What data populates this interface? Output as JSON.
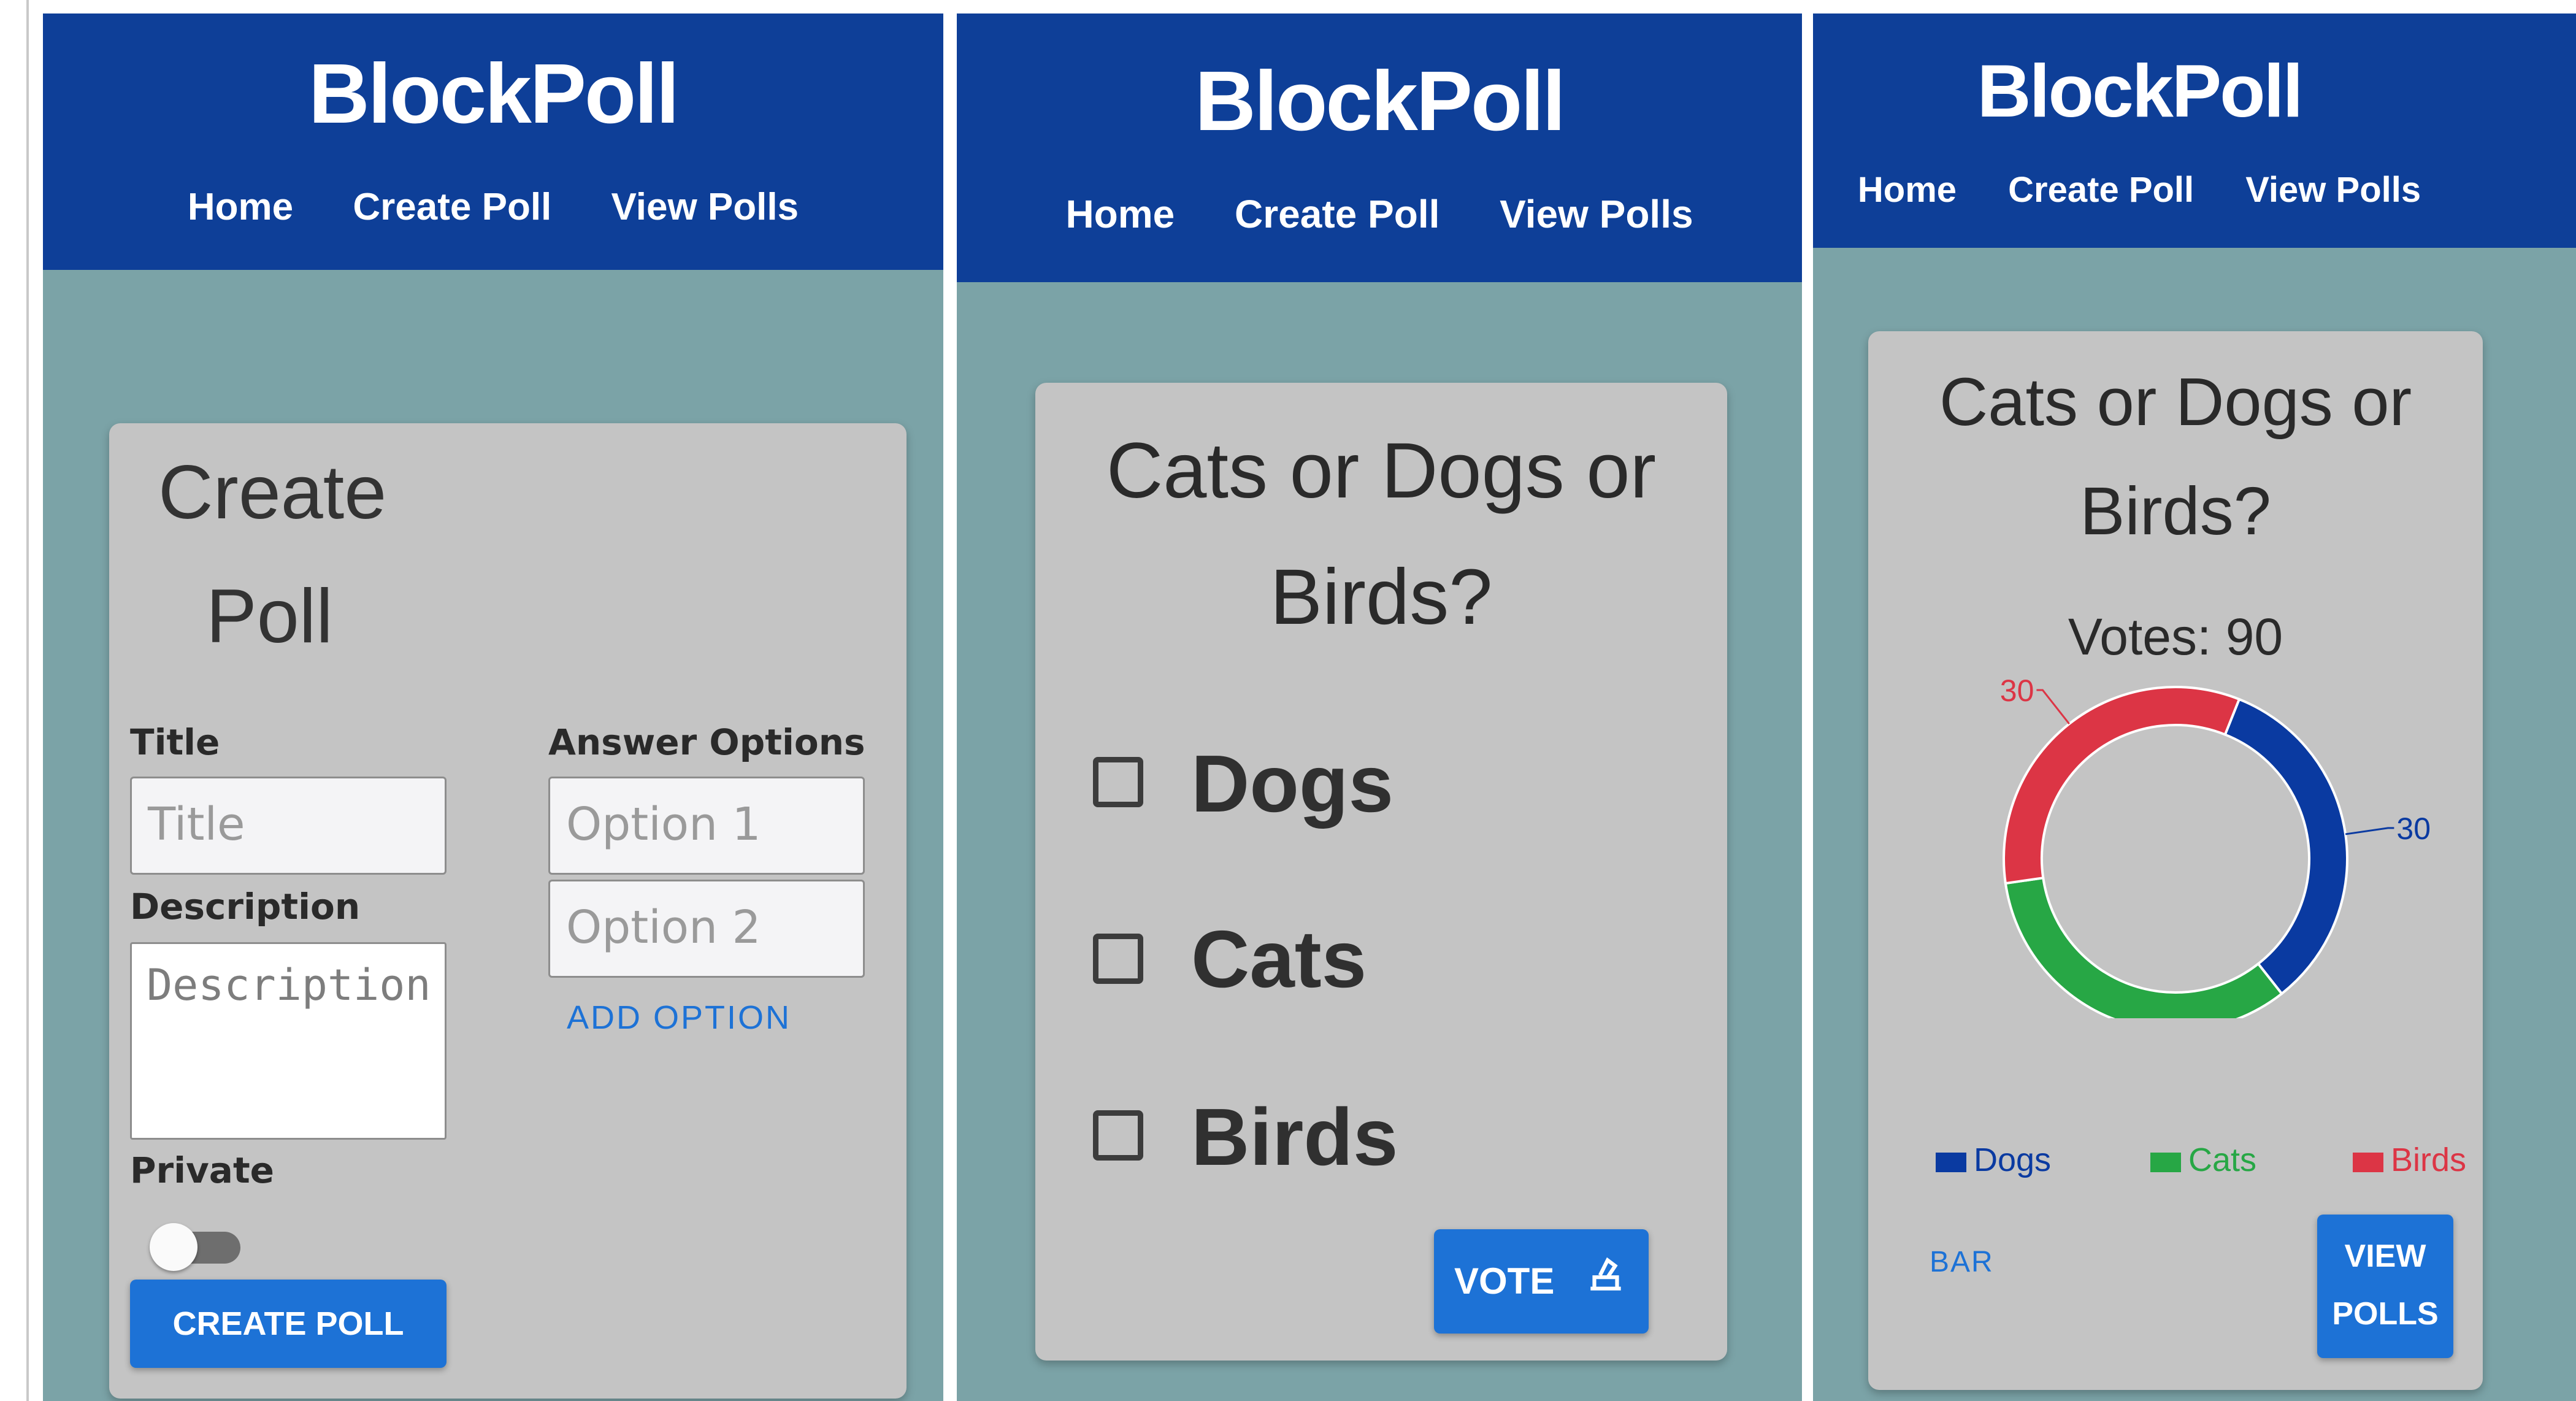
{
  "app": {
    "brand": "BlockPoll",
    "nav": [
      "Home",
      "Create Poll",
      "View Polls"
    ]
  },
  "create_panel": {
    "title_line1": "Create",
    "title_line2": "Poll",
    "title_label": "Title",
    "title_placeholder": "Title",
    "description_label": "Description",
    "description_placeholder": "Description",
    "private_label": "Private",
    "private_on": false,
    "answer_options_label": "Answer Options",
    "options": [
      "Option 1",
      "Option 2"
    ],
    "add_option_label": "ADD OPTION",
    "create_button_label": "CREATE POLL"
  },
  "vote_panel": {
    "question_line1": "Cats or Dogs or",
    "question_line2": "Birds?",
    "options": [
      {
        "label": "Dogs",
        "checked": false
      },
      {
        "label": "Cats",
        "checked": false
      },
      {
        "label": "Birds",
        "checked": false
      }
    ],
    "vote_button_label": "VOTE",
    "vote_icon": "ballot-icon"
  },
  "results_panel": {
    "question_line1": "Cats or Dogs or",
    "question_line2": "Birds?",
    "votes_text": "Votes: 90",
    "bar_toggle_label": "BAR",
    "view_polls_line1": "VIEW",
    "view_polls_line2": "POLLS"
  },
  "chart_data": {
    "type": "pie",
    "donut": true,
    "labels": [
      "Dogs",
      "Cats",
      "Birds"
    ],
    "values": [
      30,
      30,
      30
    ],
    "colors": [
      "#0a3aa1",
      "#27a745",
      "#dc3545"
    ],
    "legend": "bottom"
  },
  "colors": {
    "header": "#0e3f98",
    "background": "#7ba3a7",
    "card": "#c4c4c4",
    "button": "#1d72d6",
    "link": "#1d72d6"
  }
}
